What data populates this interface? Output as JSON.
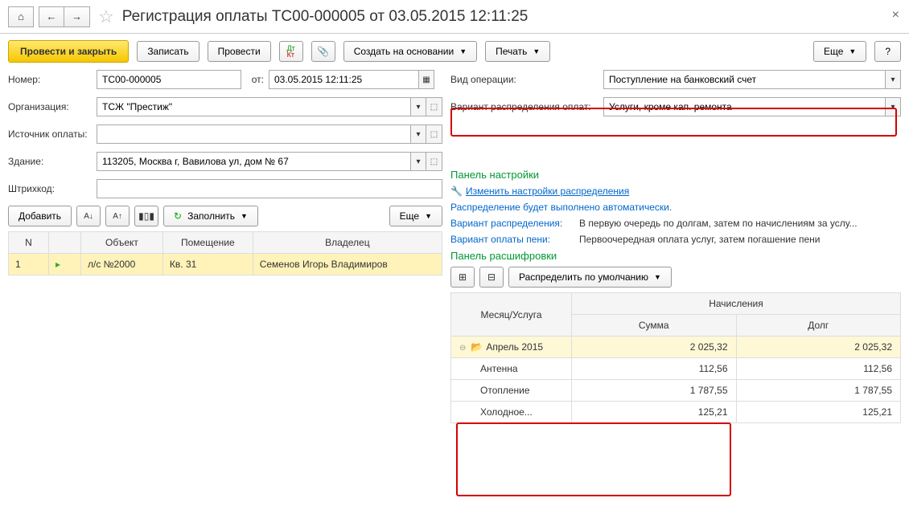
{
  "title": "Регистрация оплаты ТС00-000005 от 03.05.2015 12:11:25",
  "toolbar": {
    "submit_close": "Провести и закрыть",
    "save": "Записать",
    "submit": "Провести",
    "create_based": "Создать на основании",
    "print": "Печать",
    "more": "Еще",
    "help": "?"
  },
  "form": {
    "number_label": "Номер:",
    "number": "ТС00-000005",
    "from_label": "от:",
    "date": "03.05.2015 12:11:25",
    "org_label": "Организация:",
    "org": "ТСЖ \"Престиж\"",
    "source_label": "Источник оплаты:",
    "source": "",
    "building_label": "Здание:",
    "building": "113205, Москва г, Вавилова ул, дом № 67",
    "barcode_label": "Штрихкод:",
    "barcode": ""
  },
  "right_form": {
    "op_type_label": "Вид операции:",
    "op_type": "Поступление на банковский счет",
    "dist_variant_label": "Вариант распределения оплат:",
    "dist_variant": "Услуги, кроме кап. ремонта"
  },
  "left_toolbar": {
    "add": "Добавить",
    "fill": "Заполнить",
    "more": "Еще"
  },
  "left_table": {
    "cols": {
      "n": "N",
      "obj": "Объект",
      "room": "Помещение",
      "owner": "Владелец"
    },
    "rows": [
      {
        "n": "1",
        "obj": "л/с №2000",
        "room": "Кв. 31",
        "owner": "Семенов Игорь Владимиров"
      }
    ]
  },
  "settings_panel": {
    "title": "Панель настройки",
    "change_link": "Изменить настройки распределения",
    "auto_text": "Распределение будет выполнено автоматически.",
    "dist_label": "Вариант распределения:",
    "dist_val": "В первую очередь по долгам, затем по начислениям за услу...",
    "penalty_label": "Вариант оплаты пени:",
    "penalty_val": "Первоочередная оплата услуг, затем погашение пени"
  },
  "detail_panel": {
    "title": "Панель расшифровки",
    "distribute_btn": "Распределить по умолчанию"
  },
  "detail_table": {
    "col_month": "Месяц/Услуга",
    "col_charges": "Начисления",
    "col_sum": "Сумма",
    "col_debt": "Долг",
    "rows": [
      {
        "month": true,
        "label": "Апрель 2015",
        "sum": "2 025,32",
        "debt": "2 025,32"
      },
      {
        "label": "Антенна",
        "sum": "112,56",
        "debt": "112,56"
      },
      {
        "label": "Отопление",
        "sum": "1 787,55",
        "debt": "1 787,55"
      },
      {
        "label": "Холодное...",
        "sum": "125,21",
        "debt": "125,21"
      }
    ]
  }
}
